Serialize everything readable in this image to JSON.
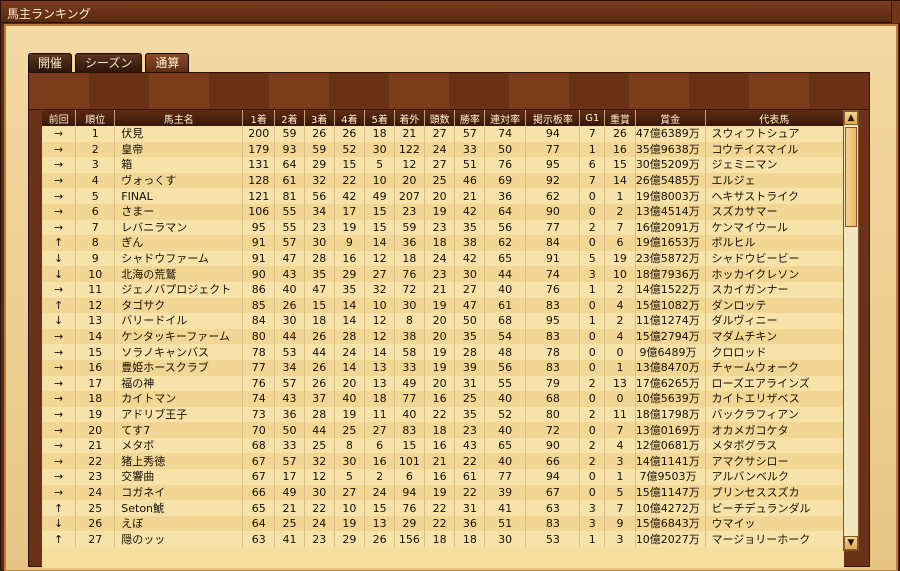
{
  "window": {
    "title": "馬主ランキング"
  },
  "tabs": [
    {
      "label": "開催",
      "active": false
    },
    {
      "label": "シーズン",
      "active": false
    },
    {
      "label": "通算",
      "active": true
    }
  ],
  "table": {
    "headers": [
      "前回",
      "順位",
      "馬主名",
      "1着",
      "2着",
      "3着",
      "4着",
      "5着",
      "着外",
      "頭数",
      "勝率",
      "連対率",
      "掲示板率",
      "G1",
      "重賞",
      "賞金",
      "代表馬"
    ],
    "rows": [
      [
        "→",
        "1",
        "伏見",
        "200",
        "59",
        "26",
        "26",
        "18",
        "21",
        "27",
        "57",
        "74",
        "94",
        "7",
        "26",
        "47億6389万",
        "スウィフトシュア"
      ],
      [
        "→",
        "2",
        "皇帝",
        "179",
        "93",
        "59",
        "52",
        "30",
        "122",
        "24",
        "33",
        "50",
        "77",
        "1",
        "16",
        "35億9638万",
        "コウテイスマイル"
      ],
      [
        "→",
        "3",
        "箱",
        "131",
        "64",
        "29",
        "15",
        "5",
        "12",
        "27",
        "51",
        "76",
        "95",
        "6",
        "15",
        "30億5209万",
        "ジェミニマン"
      ],
      [
        "→",
        "4",
        "ヴォっくす",
        "128",
        "61",
        "32",
        "22",
        "10",
        "20",
        "25",
        "46",
        "69",
        "92",
        "7",
        "14",
        "26億5485万",
        "エルジェ"
      ],
      [
        "→",
        "5",
        "FINAL",
        "121",
        "81",
        "56",
        "42",
        "49",
        "207",
        "20",
        "21",
        "36",
        "62",
        "0",
        "1",
        "19億8003万",
        "ヘキサストライク"
      ],
      [
        "→",
        "6",
        "さまー",
        "106",
        "55",
        "34",
        "17",
        "15",
        "23",
        "19",
        "42",
        "64",
        "90",
        "0",
        "2",
        "13億4514万",
        "スズカサマー"
      ],
      [
        "→",
        "7",
        "レバニラマン",
        "95",
        "55",
        "23",
        "19",
        "15",
        "59",
        "23",
        "35",
        "56",
        "77",
        "2",
        "7",
        "16億2091万",
        "ケンマイウール"
      ],
      [
        "↑",
        "8",
        "ぎん",
        "91",
        "57",
        "30",
        "9",
        "14",
        "36",
        "18",
        "38",
        "62",
        "84",
        "0",
        "6",
        "19億1653万",
        "ボルヒル"
      ],
      [
        "↓",
        "9",
        "シャドウファーム",
        "91",
        "47",
        "28",
        "16",
        "12",
        "18",
        "24",
        "42",
        "65",
        "91",
        "5",
        "19",
        "23億5872万",
        "シャドウビービー"
      ],
      [
        "↓",
        "10",
        "北海の荒鷲",
        "90",
        "43",
        "35",
        "29",
        "27",
        "76",
        "23",
        "30",
        "44",
        "74",
        "3",
        "10",
        "18億7936万",
        "ホッカイクレソン"
      ],
      [
        "→",
        "11",
        "ジェノバプロジェクト",
        "86",
        "40",
        "47",
        "35",
        "32",
        "72",
        "21",
        "27",
        "40",
        "76",
        "1",
        "2",
        "14億1522万",
        "スカイガンナー"
      ],
      [
        "↑",
        "12",
        "タゴサク",
        "85",
        "26",
        "15",
        "14",
        "10",
        "30",
        "19",
        "47",
        "61",
        "83",
        "0",
        "4",
        "15億1082万",
        "ダンロッテ"
      ],
      [
        "↓",
        "13",
        "バリードイル",
        "84",
        "30",
        "18",
        "14",
        "12",
        "8",
        "20",
        "50",
        "68",
        "95",
        "1",
        "2",
        "11億1274万",
        "ダルヴィニー"
      ],
      [
        "→",
        "14",
        "ケンタッキーファーム",
        "80",
        "44",
        "26",
        "28",
        "12",
        "38",
        "20",
        "35",
        "54",
        "83",
        "0",
        "4",
        "15億2794万",
        "マダムチキン"
      ],
      [
        "→",
        "15",
        "ソラノキャンバス",
        "78",
        "53",
        "44",
        "24",
        "14",
        "58",
        "19",
        "28",
        "48",
        "78",
        "0",
        "0",
        "9億6489万",
        "クロロッド"
      ],
      [
        "→",
        "16",
        "豊姫ホースクラブ",
        "77",
        "34",
        "26",
        "14",
        "13",
        "33",
        "19",
        "39",
        "56",
        "83",
        "0",
        "1",
        "13億8470万",
        "チャームウォーク"
      ],
      [
        "→",
        "17",
        "福の神",
        "76",
        "57",
        "26",
        "20",
        "13",
        "49",
        "20",
        "31",
        "55",
        "79",
        "2",
        "13",
        "17億6265万",
        "ローズエアラインズ"
      ],
      [
        "→",
        "18",
        "カイトマン",
        "74",
        "43",
        "37",
        "40",
        "18",
        "77",
        "16",
        "25",
        "40",
        "68",
        "0",
        "0",
        "10億5639万",
        "カイトエリザベス"
      ],
      [
        "→",
        "19",
        "アドリブ王子",
        "73",
        "36",
        "28",
        "19",
        "11",
        "40",
        "22",
        "35",
        "52",
        "80",
        "2",
        "11",
        "18億1798万",
        "バックラフィアン"
      ],
      [
        "→",
        "20",
        "てす7",
        "70",
        "50",
        "44",
        "25",
        "27",
        "83",
        "18",
        "23",
        "40",
        "72",
        "0",
        "7",
        "13億0169万",
        "オカメガコケタ"
      ],
      [
        "→",
        "21",
        "メタボ",
        "68",
        "33",
        "25",
        "8",
        "6",
        "15",
        "16",
        "43",
        "65",
        "90",
        "2",
        "4",
        "12億0681万",
        "メタボグラス"
      ],
      [
        "→",
        "22",
        "猪上秀徳",
        "67",
        "57",
        "32",
        "30",
        "16",
        "101",
        "21",
        "22",
        "40",
        "66",
        "2",
        "3",
        "14億1141万",
        "アマクサシロー"
      ],
      [
        "→",
        "23",
        "交響曲",
        "67",
        "17",
        "12",
        "5",
        "2",
        "6",
        "16",
        "61",
        "77",
        "94",
        "0",
        "1",
        "7億9503万",
        "アルバンベルク"
      ],
      [
        "→",
        "24",
        "コガネイ",
        "66",
        "49",
        "30",
        "27",
        "24",
        "94",
        "19",
        "22",
        "39",
        "67",
        "0",
        "5",
        "15億1147万",
        "プリンセススズカ"
      ],
      [
        "↑",
        "25",
        "Seton鯱",
        "65",
        "21",
        "22",
        "10",
        "15",
        "76",
        "22",
        "31",
        "41",
        "63",
        "3",
        "7",
        "10億4272万",
        "ビーチデュランダル"
      ],
      [
        "↓",
        "26",
        "えぼ",
        "64",
        "25",
        "24",
        "19",
        "13",
        "29",
        "22",
        "36",
        "51",
        "83",
        "3",
        "9",
        "15億6843万",
        "ウマイッ"
      ],
      [
        "↑",
        "27",
        "隠のッッ",
        "63",
        "41",
        "23",
        "29",
        "26",
        "156",
        "18",
        "18",
        "30",
        "53",
        "1",
        "3",
        "10億2027万",
        "マージョリーホーク"
      ]
    ]
  },
  "scrollbar": {
    "up": "▲",
    "down": "▼"
  }
}
